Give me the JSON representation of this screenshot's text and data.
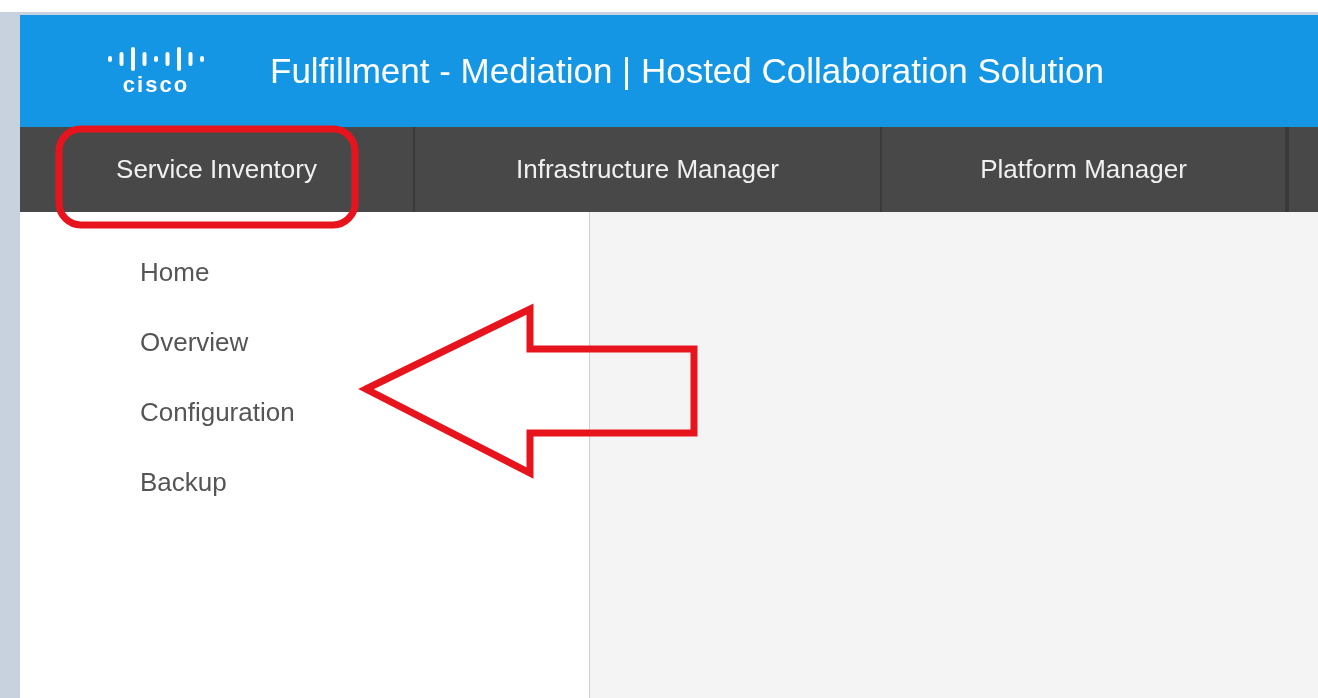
{
  "header": {
    "logo_text": "cisco",
    "title": "Fulfillment - Mediation | Hosted Collaboration Solution"
  },
  "nav_tabs": [
    {
      "label": "Service Inventory"
    },
    {
      "label": "Infrastructure Manager"
    },
    {
      "label": "Platform Manager"
    }
  ],
  "sidebar": {
    "items": [
      {
        "label": "Home"
      },
      {
        "label": "Overview"
      },
      {
        "label": "Configuration"
      },
      {
        "label": "Backup"
      }
    ]
  }
}
